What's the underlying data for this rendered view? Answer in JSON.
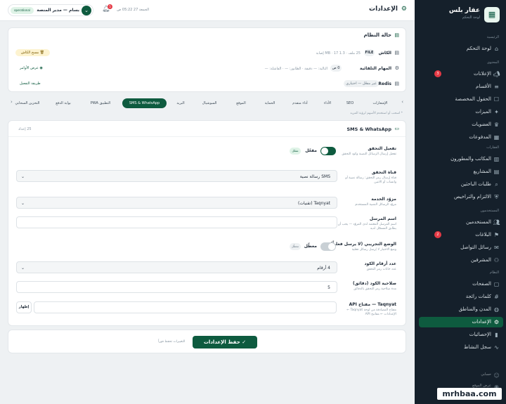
{
  "brand": {
    "name": "عقار بلس",
    "subtitle": "لوحة التحكم",
    "logo_icon": "grid-icon"
  },
  "sidebar": {
    "sections": [
      {
        "label": "الرئيسية",
        "items": [
          {
            "label": "لوحة التحكم",
            "icon": "home-icon"
          }
        ]
      },
      {
        "label": "المحتوى",
        "items": [
          {
            "label": "الإعلانات",
            "icon": "megaphone-icon",
            "badge": "3"
          },
          {
            "label": "الأقسام",
            "icon": "layers-icon"
          },
          {
            "label": "الحقول المخصصة",
            "icon": "fields-icon"
          },
          {
            "label": "الميزات",
            "icon": "star-icon"
          },
          {
            "label": "العضويات",
            "icon": "crown-icon"
          },
          {
            "label": "المدفوعات",
            "icon": "card-icon"
          }
        ]
      },
      {
        "label": "العقارات",
        "items": [
          {
            "label": "المكاتب والمطورون",
            "icon": "building-icon"
          },
          {
            "label": "المشاريع",
            "icon": "project-icon"
          },
          {
            "label": "طلبات الباحثين",
            "icon": "search-icon"
          },
          {
            "label": "الالتزام والتراخيص",
            "icon": "shield-icon"
          }
        ]
      },
      {
        "label": "المستخدمون",
        "items": [
          {
            "label": "المستخدمين",
            "icon": "users-icon"
          },
          {
            "label": "البلاغات",
            "icon": "flag-icon",
            "badge": "2"
          },
          {
            "label": "رسائل التواصل",
            "icon": "mail-icon"
          },
          {
            "label": "المشرفين",
            "icon": "admin-icon"
          }
        ]
      },
      {
        "label": "النظام",
        "items": [
          {
            "label": "الصفحات",
            "icon": "page-icon"
          },
          {
            "label": "كلمات رائجة",
            "icon": "tag-icon"
          },
          {
            "label": "المدن والمناطق",
            "icon": "globe-icon"
          },
          {
            "label": "الإعدادات",
            "icon": "gear-icon",
            "active": true
          },
          {
            "label": "الإحصائيات",
            "icon": "chart-icon"
          },
          {
            "label": "سجل النشاط",
            "icon": "activity-icon"
          }
        ]
      }
    ],
    "footer": [
      {
        "label": "حسابي",
        "icon": "user-icon"
      },
      {
        "label": "عرض الموقع",
        "icon": "eye-icon"
      }
    ]
  },
  "topbar": {
    "title": "الإعدادات",
    "date": "الجمعة 27 05:22 ص",
    "notification_count": "5",
    "user_name": "بسام — مدير المنصة",
    "user_status": "operational"
  },
  "status_card": {
    "title": "حالة النظام",
    "rows": [
      {
        "name": "الكاش",
        "tag": "FILE",
        "meta": "25 ملف · 1.3 MB · 17 إصابة",
        "action": "مسح الكاش"
      },
      {
        "name": "المهام التلقائية",
        "meta": "التالية: — دقيقة · الطابور: — · الفاشلة: —",
        "badge": "0 ص",
        "action": "عرض الأوامر"
      },
      {
        "name": "Redis",
        "badge": "غير مفعّل — اختياري",
        "action": "طريقة التفعيل"
      }
    ]
  },
  "tabs": [
    "الإشعارات",
    "SEO",
    "الأداء",
    "أداء متقدم",
    "الحماية",
    "الموقع",
    "السوشيال",
    "البريد",
    "SMS & WhatsApp",
    "التطبيق PWA",
    "بوابة الدفع",
    "التخزين السحابي"
  ],
  "active_tab": "SMS & WhatsApp",
  "hint": "* اسحب أو استخدم الأسهم لرؤية المزيد",
  "sms_card": {
    "title": "SMS & WhatsApp",
    "count": "25 إعداد",
    "fields": [
      {
        "label": "تفعيل التحقق",
        "help": "تفعيل إرسال الرسائل النصية وكود التحقق",
        "type": "toggle",
        "state": "مفعّل",
        "pill": "مفعّل"
      },
      {
        "label": "قناة التحقق",
        "help": "قناة إرسال رمز التحقق: رسالة نصية أو واتساب أو الاثنين",
        "type": "select",
        "value": "SMS رسالة نصية"
      },
      {
        "label": "مزوّد الخدمة",
        "help": "مزوّد الرسائل النصية المستخدم",
        "type": "select",
        "value": "Taqnyat (تقنيات)"
      },
      {
        "label": "اسم المرسل",
        "help": "اسم المرسل المعتمد لدى المزوّد — يجب أن يطابق المسجّل لديه",
        "type": "input",
        "value": ""
      },
      {
        "label": "الوضع التجريبي (لا يرسل فعلياً)",
        "help": "وضع الاختبار لا يُرسل رسائل فعلية",
        "type": "toggle",
        "state": "معطّل",
        "pill": "معطّل"
      },
      {
        "label": "عدد أرقام الكود",
        "help": "عدد خانات رمز التحقق",
        "type": "select",
        "value": "4 أرقام"
      },
      {
        "label": "صلاحية الكود (دقائق)",
        "help": "مدة صلاحية رمز التحقق بالدقائق",
        "type": "input",
        "value": "5"
      },
      {
        "label": "Taqnyat — مفتاح API",
        "help": "مفتاح المصادقة من لوحة Taqnyat ← الإعدادات ← مفاتيح API",
        "type": "input",
        "value": "",
        "action": "إظهار"
      }
    ]
  },
  "footer_bar": {
    "save": "حفظ الإعدادات",
    "note": "التغييرات تحفظ فوراً"
  },
  "watermark": "mrhbaa.com",
  "colors": {
    "primary": "#0e5b3f",
    "sidebar": "#15202b",
    "danger": "#e53945",
    "warning_bg": "#fdf3d0"
  }
}
